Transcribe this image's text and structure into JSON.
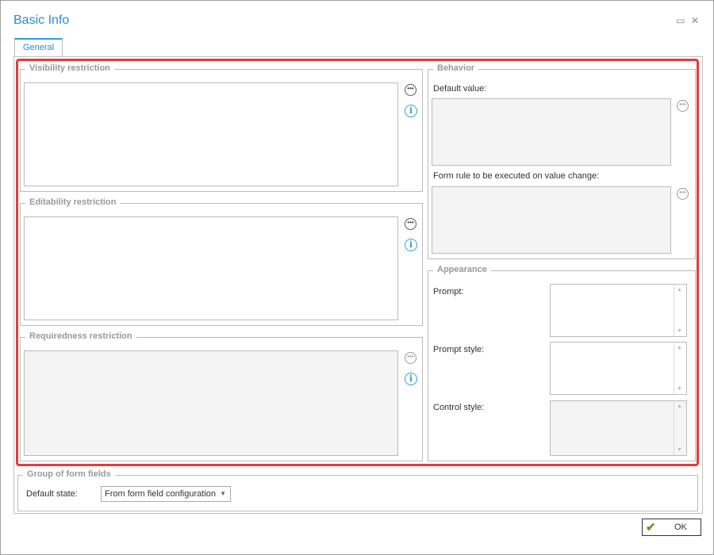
{
  "window": {
    "title": "Basic Info",
    "maximize_icon": "maximize-icon",
    "close_icon": "close-icon"
  },
  "tabs": [
    {
      "label": "General",
      "active": true
    }
  ],
  "left": {
    "visibility": {
      "label": "Visibility restriction",
      "value": ""
    },
    "editability": {
      "label": "Editability restriction",
      "value": ""
    },
    "requiredness": {
      "label": "Requiredness restriction",
      "value": "",
      "disabled": true
    }
  },
  "behavior": {
    "label": "Behavior",
    "default_value_label": "Default value:",
    "default_value": "",
    "form_rule_label": "Form rule to be executed on value change:",
    "form_rule": ""
  },
  "appearance": {
    "label": "Appearance",
    "prompt_label": "Prompt:",
    "prompt_style_label": "Prompt style:",
    "control_style_label": "Control style:"
  },
  "group": {
    "label": "Group of form fields",
    "default_state_label": "Default state:",
    "default_state_value": "From form field configuration"
  },
  "buttons": {
    "ok": "OK"
  },
  "icons": {
    "ellipsis": "•••",
    "info": "i",
    "check": "✔",
    "maximize": "▭",
    "close": "✕",
    "scroll_up": "▲",
    "scroll_down": "▼",
    "dropdown": "▼"
  },
  "colors": {
    "accent": "#2aa0e0",
    "highlight": "#e83a3a",
    "ok_check": "#5a9e2a"
  }
}
